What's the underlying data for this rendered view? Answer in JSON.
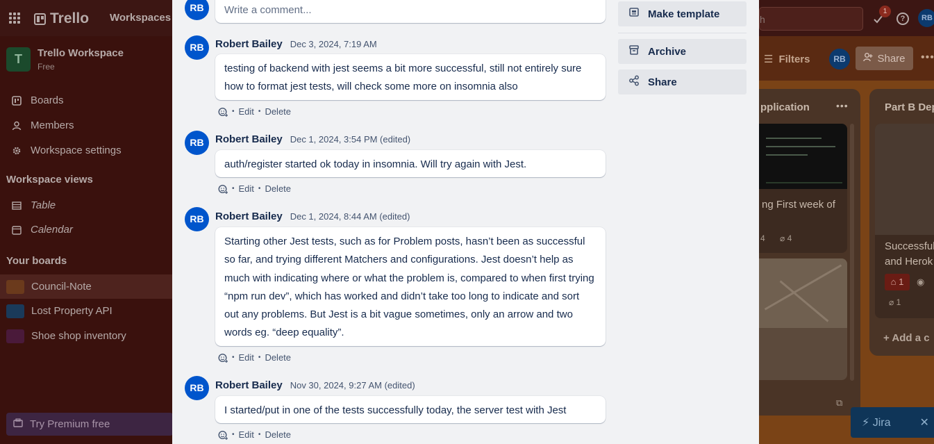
{
  "app": {
    "logo_text": "Trello",
    "nav_workspaces": "Workspaces",
    "search_fragment": "h",
    "notification_count": "1",
    "help_symbol": "?",
    "user_initials": "RB"
  },
  "sidebar": {
    "workspace_initial": "T",
    "workspace_name": "Trello Workspace",
    "workspace_plan": "Free",
    "items": [
      {
        "label": "Boards",
        "icon": "boards-icon"
      },
      {
        "label": "Members",
        "icon": "person-icon"
      },
      {
        "label": "Workspace settings",
        "icon": "gear-icon"
      }
    ],
    "views_header": "Workspace views",
    "views": [
      {
        "label": "Table",
        "icon": "table-icon"
      },
      {
        "label": "Calendar",
        "icon": "calendar-icon"
      }
    ],
    "boards_header": "Your boards",
    "boards": [
      {
        "label": "Council-Note",
        "color": "#6b3a1c"
      },
      {
        "label": "Lost Property API",
        "color": "#1a3a5a"
      },
      {
        "label": "Shoe shop inventory",
        "color": "#4a1a3a"
      }
    ],
    "premium_label": "Try Premium free"
  },
  "board": {
    "filters_label": "Filters",
    "share_label": "Share",
    "list1_title_fragment": "pplication",
    "list1_card_text": "ng First week of",
    "list1_card_meta_comments": "4",
    "list1_card_meta_attachments": "4",
    "list2_title_fragment": "Part B Dep",
    "list2_card_text": "Successful\nand Herok",
    "list2_card_badge": "1",
    "list2_card_meta": "1",
    "add_card_label": "+  Add a c",
    "jira_label": "Jira",
    "jira_close": "✕"
  },
  "modal": {
    "new_comment_placeholder": "Write a comment...",
    "actions": {
      "make_template": "Make template",
      "archive": "Archive",
      "share": "Share"
    },
    "action_labels": {
      "edit": "Edit",
      "delete": "Delete",
      "separator": "•"
    },
    "comments": [
      {
        "initials": "RB",
        "author": "Robert Bailey",
        "date": "Dec 3, 2024, 7:19 AM",
        "text": "testing of backend with jest seems a bit more successful, still not entirely sure how to format jest tests, will check some more on insomnia also"
      },
      {
        "initials": "RB",
        "author": "Robert Bailey",
        "date": "Dec 1, 2024, 3:54 PM (edited)",
        "text": "auth/register started ok today in insomnia. Will try again with Jest."
      },
      {
        "initials": "RB",
        "author": "Robert Bailey",
        "date": "Dec 1, 2024, 8:44 AM (edited)",
        "text": "Starting other Jest tests, such as for Problem posts, hasn’t been as successful so far, and trying different Matchers and configurations. Jest doesn’t help as much with indicating where or what the problem is, compared to when first trying “npm run dev”, which has worked and didn’t take too long to indicate and sort out any problems. But Jest is a bit vague sometimes, only an arrow and two words eg. “deep equality”."
      },
      {
        "initials": "RB",
        "author": "Robert Bailey",
        "date": "Nov 30, 2024, 9:27 AM (edited)",
        "text": "I started/put in one of the tests successfully today, the server test with Jest"
      }
    ]
  }
}
